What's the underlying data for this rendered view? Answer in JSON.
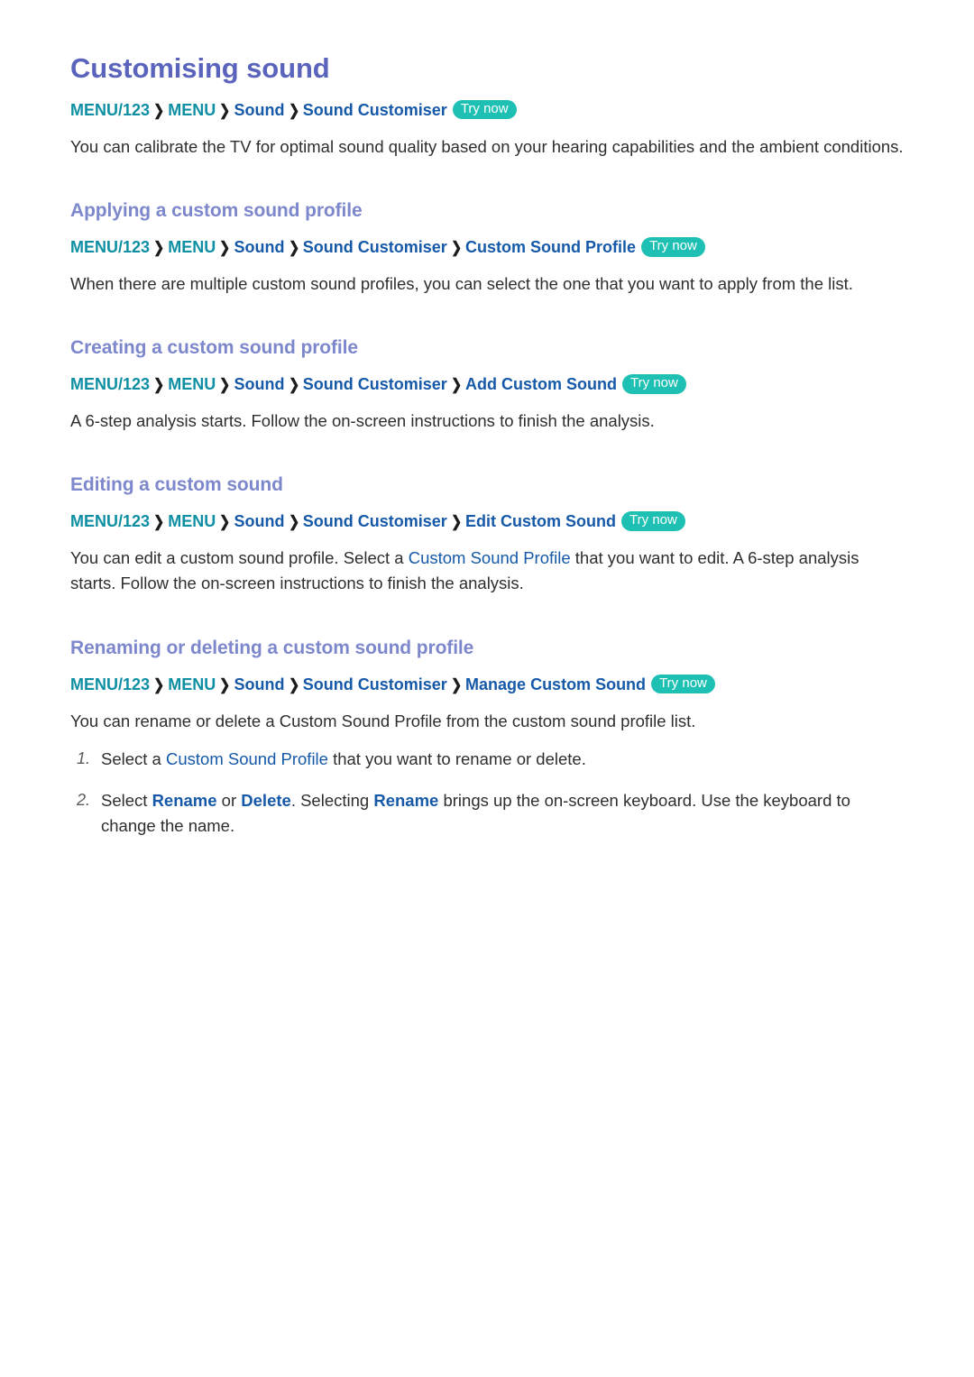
{
  "page": {
    "title": "Customising sound",
    "intro_path": {
      "segments": [
        {
          "text": "MENU/123",
          "tone": "teal"
        },
        {
          "text": "MENU",
          "tone": "teal"
        },
        {
          "text": "Sound",
          "tone": "blue"
        },
        {
          "text": "Sound Customiser",
          "tone": "blue"
        }
      ],
      "separator": "❯",
      "badge": "Try now"
    },
    "intro_text": "You can calibrate the TV for optimal sound quality based on your hearing capabilities and the ambient conditions."
  },
  "sections": [
    {
      "heading": "Applying a custom sound profile",
      "path": {
        "segments": [
          {
            "text": "MENU/123",
            "tone": "teal"
          },
          {
            "text": "MENU",
            "tone": "teal"
          },
          {
            "text": "Sound",
            "tone": "blue"
          },
          {
            "text": "Sound Customiser",
            "tone": "blue"
          },
          {
            "text": "Custom Sound Profile",
            "tone": "blue"
          }
        ],
        "badge": "Try now"
      },
      "body": "When there are multiple custom sound profiles, you can select the one that you want to apply from the list."
    },
    {
      "heading": "Creating a custom sound profile",
      "path": {
        "segments": [
          {
            "text": "MENU/123",
            "tone": "teal"
          },
          {
            "text": "MENU",
            "tone": "teal"
          },
          {
            "text": "Sound",
            "tone": "blue"
          },
          {
            "text": "Sound Customiser",
            "tone": "blue"
          },
          {
            "text": "Add Custom Sound",
            "tone": "blue"
          }
        ],
        "badge": "Try now"
      },
      "body": "A 6-step analysis starts. Follow the on-screen instructions to finish the analysis."
    },
    {
      "heading": "Editing a custom sound",
      "path": {
        "segments": [
          {
            "text": "MENU/123",
            "tone": "teal"
          },
          {
            "text": "MENU",
            "tone": "teal"
          },
          {
            "text": "Sound",
            "tone": "blue"
          },
          {
            "text": "Sound Customiser",
            "tone": "blue"
          },
          {
            "text": "Edit Custom Sound",
            "tone": "blue"
          }
        ],
        "badge": "Try now"
      },
      "body_parts": [
        {
          "text": "You can edit a custom sound profile. Select a ",
          "style": "plain"
        },
        {
          "text": "Custom Sound Profile",
          "style": "blue"
        },
        {
          "text": " that you want to edit. A 6-step analysis starts. Follow the on-screen instructions to finish the analysis.",
          "style": "plain"
        }
      ]
    },
    {
      "heading": "Renaming or deleting a custom sound profile",
      "path": {
        "segments": [
          {
            "text": "MENU/123",
            "tone": "teal"
          },
          {
            "text": "MENU",
            "tone": "teal"
          },
          {
            "text": "Sound",
            "tone": "blue"
          },
          {
            "text": "Sound Customiser",
            "tone": "blue"
          },
          {
            "text": "Manage Custom Sound",
            "tone": "blue"
          }
        ],
        "badge": "Try now"
      },
      "body": "You can rename or delete a Custom Sound Profile from the custom sound profile list.",
      "steps": [
        {
          "num": "1.",
          "parts": [
            {
              "text": "Select a ",
              "style": "plain"
            },
            {
              "text": "Custom Sound Profile",
              "style": "blue"
            },
            {
              "text": " that you want to rename or delete.",
              "style": "plain"
            }
          ]
        },
        {
          "num": "2.",
          "parts": [
            {
              "text": "Select ",
              "style": "plain"
            },
            {
              "text": "Rename",
              "style": "blue-bold"
            },
            {
              "text": " or ",
              "style": "plain"
            },
            {
              "text": "Delete",
              "style": "blue-bold"
            },
            {
              "text": ". Selecting ",
              "style": "plain"
            },
            {
              "text": "Rename",
              "style": "blue-bold"
            },
            {
              "text": " brings up the on-screen keyboard. Use the keyboard to change the name.",
              "style": "plain"
            }
          ]
        }
      ]
    }
  ],
  "colors": {
    "title": "#5b64bd",
    "heading": "#7d87cb",
    "path_teal": "#0e8fa3",
    "path_blue": "#1559a8",
    "badge_bg": "#1fc0b4",
    "body": "#2e2e2e"
  }
}
